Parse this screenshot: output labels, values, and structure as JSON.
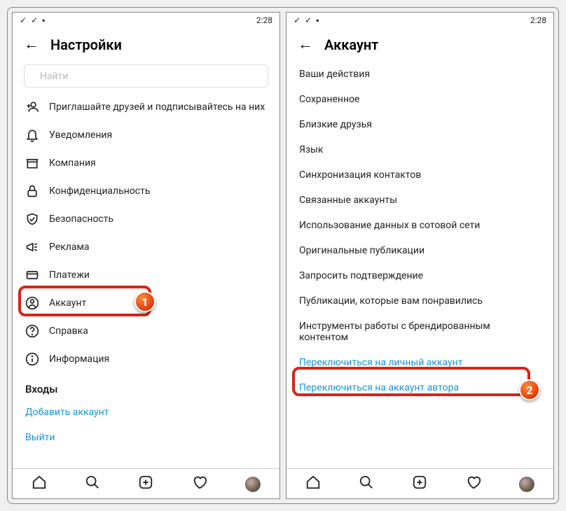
{
  "status": {
    "time": "2:28"
  },
  "left": {
    "title": "Настройки",
    "search_placeholder": "Найти",
    "items": [
      {
        "label": "Приглашайте друзей и подписывайтесь на них"
      },
      {
        "label": "Уведомления"
      },
      {
        "label": "Компания"
      },
      {
        "label": "Конфиденциальность"
      },
      {
        "label": "Безопасность"
      },
      {
        "label": "Реклама"
      },
      {
        "label": "Платежи"
      },
      {
        "label": "Аккаунт"
      },
      {
        "label": "Справка"
      },
      {
        "label": "Информация"
      }
    ],
    "logins_header": "Входы",
    "add_account": "Добавить аккаунт",
    "logout": "Выйти"
  },
  "right": {
    "title": "Аккаунт",
    "items": [
      {
        "label": "Ваши действия"
      },
      {
        "label": "Сохраненное"
      },
      {
        "label": "Близкие друзья"
      },
      {
        "label": "Язык"
      },
      {
        "label": "Синхронизация контактов"
      },
      {
        "label": "Связанные аккаунты"
      },
      {
        "label": "Использование данных в сотовой сети"
      },
      {
        "label": "Оригинальные публикации"
      },
      {
        "label": "Запросить подтверждение"
      },
      {
        "label": "Публикации, которые вам понравились"
      },
      {
        "label": "Инструменты работы с брендированным контентом"
      }
    ],
    "switch_personal": "Переключиться на личный аккаунт",
    "switch_author": "Переключиться на аккаунт автора"
  },
  "badges": {
    "one": "1",
    "two": "2"
  }
}
